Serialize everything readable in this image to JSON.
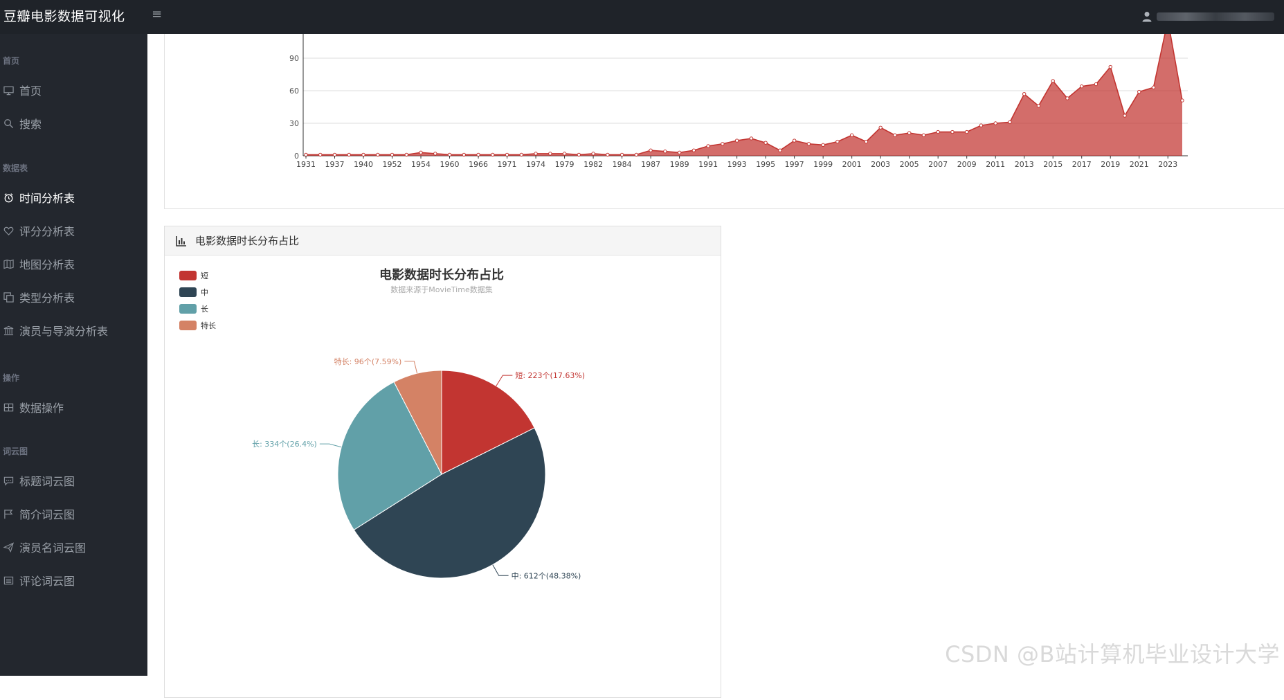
{
  "app": {
    "title": "豆瓣电影数据可视化",
    "menu_toggle": "≡"
  },
  "sidebar": {
    "sections": [
      {
        "label": "首页"
      },
      {
        "label": "数据表"
      },
      {
        "label": "操作"
      },
      {
        "label": "词云图"
      }
    ],
    "items": [
      {
        "label": "首页",
        "icon": "monitor-icon"
      },
      {
        "label": "搜索",
        "icon": "search-icon"
      },
      {
        "label": "时间分析表",
        "icon": "alarm-clock-icon"
      },
      {
        "label": "评分分析表",
        "icon": "heart-icon"
      },
      {
        "label": "地图分析表",
        "icon": "map-icon"
      },
      {
        "label": "类型分析表",
        "icon": "copy-icon"
      },
      {
        "label": "演员与导演分析表",
        "icon": "bank-icon"
      },
      {
        "label": "数据操作",
        "icon": "table-icon"
      },
      {
        "label": "标题词云图",
        "icon": "comment-icon"
      },
      {
        "label": "简介词云图",
        "icon": "flag-icon"
      },
      {
        "label": "演员名词云图",
        "icon": "send-icon"
      },
      {
        "label": "评论词云图",
        "icon": "list-icon"
      }
    ],
    "active_item": "时间分析表"
  },
  "colors": {
    "topbar": "#1f2329",
    "sidebar": "#23272e",
    "line_area": "#c23531",
    "pie": [
      "#c23531",
      "#2f4554",
      "#61a0a8",
      "#d48265"
    ]
  },
  "pie_panel": {
    "header": "电影数据时长分布占比"
  },
  "watermark": "CSDN @B站计算机毕业设计大学",
  "chart_data": [
    {
      "type": "area",
      "x": [
        "1931",
        "1934",
        "1937",
        "1939",
        "1940",
        "1950",
        "1952",
        "1953",
        "1954",
        "1957",
        "1960",
        "1962",
        "1966",
        "1968",
        "1971",
        "1972",
        "1974",
        "1977",
        "1979",
        "1980",
        "1982",
        "1983",
        "1984",
        "1986",
        "1987",
        "1988",
        "1989",
        "1990",
        "1991",
        "1992",
        "1993",
        "1994",
        "1995",
        "1996",
        "1997",
        "1998",
        "1999",
        "2000",
        "2001",
        "2002",
        "2003",
        "2004",
        "2005",
        "2006",
        "2007",
        "2008",
        "2009",
        "2010",
        "2011",
        "2012",
        "2013",
        "2014",
        "2015",
        "2016",
        "2017",
        "2018",
        "2019",
        "2020",
        "2021",
        "2022",
        "2023",
        "2024"
      ],
      "tick_labels": [
        "1931",
        "1937",
        "1940",
        "1952",
        "1954",
        "1960",
        "1966",
        "1971",
        "1974",
        "1979",
        "1982",
        "1984",
        "1987",
        "1989",
        "1991",
        "1993",
        "1995",
        "1997",
        "1999",
        "2001",
        "2003",
        "2005",
        "2007",
        "2009",
        "2011",
        "2013",
        "2015",
        "2017",
        "2019",
        "2021",
        "2023"
      ],
      "y_ticks": [
        0,
        30,
        60,
        90
      ],
      "values": [
        1,
        1,
        1,
        1,
        1,
        1,
        1,
        1,
        3,
        2,
        1,
        1,
        1,
        1,
        1,
        1,
        2,
        2,
        2,
        1,
        2,
        1,
        1,
        1,
        5,
        4,
        3,
        5,
        9,
        11,
        14,
        16,
        12,
        5,
        14,
        11,
        10,
        13,
        19,
        13,
        26,
        19,
        21,
        19,
        22,
        22,
        22,
        28,
        30,
        31,
        57,
        46,
        69,
        53,
        64,
        66,
        82,
        37,
        59,
        63,
        125,
        51
      ],
      "ylim": [
        0,
        110
      ],
      "grid": true,
      "series": [
        {
          "values_ref": "values"
        }
      ]
    },
    {
      "type": "pie",
      "title": "电影数据时长分布占比",
      "subtitle": "数据来源于MovieTime数据集",
      "legend": [
        "短",
        "中",
        "长",
        "特长"
      ],
      "legend_position": "top-left",
      "slices": [
        {
          "name": "短",
          "value": 223,
          "label": "短: 223个(17.63%)"
        },
        {
          "name": "中",
          "value": 612,
          "label": "中: 612个(48.38%)"
        },
        {
          "name": "长",
          "value": 334,
          "label": "长: 334个(26.4%)"
        },
        {
          "name": "特长",
          "value": 96,
          "label": "特长: 96个(7.59%)"
        }
      ]
    }
  ]
}
